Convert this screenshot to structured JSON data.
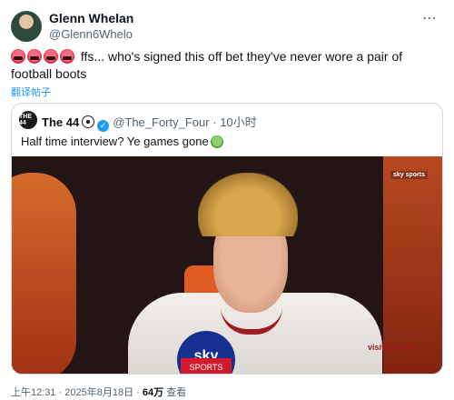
{
  "author": {
    "name": "Glenn Whelan",
    "handle": "@Glenn6Whelo"
  },
  "tweet": {
    "emojis": [
      "rage-emoji",
      "rage-emoji",
      "rage-emoji",
      "rage-emoji"
    ],
    "text": "ffs... who's signed this off bet they've never wore a pair of football boots",
    "translate_label": "翻译帖子"
  },
  "quote": {
    "avatar_text": "THE 44",
    "name": "The 44",
    "handle": "@The_Forty_Four",
    "dot": "·",
    "time": "10小时",
    "text": "Half time interview? Ye games gone"
  },
  "video": {
    "channel_logo": "sky sports",
    "mic_label": "sky",
    "mic_sub_label": "SPORTS",
    "shirt_sponsor": "visit rwanda"
  },
  "meta": {
    "timestamp": "上午12:31 · 2025年8月18日 · ",
    "views": "64万",
    "views_suffix": " 查看"
  },
  "colors": {
    "link": "#1d9bf0",
    "secondary_text": "#536471",
    "border": "#cfd9de"
  }
}
